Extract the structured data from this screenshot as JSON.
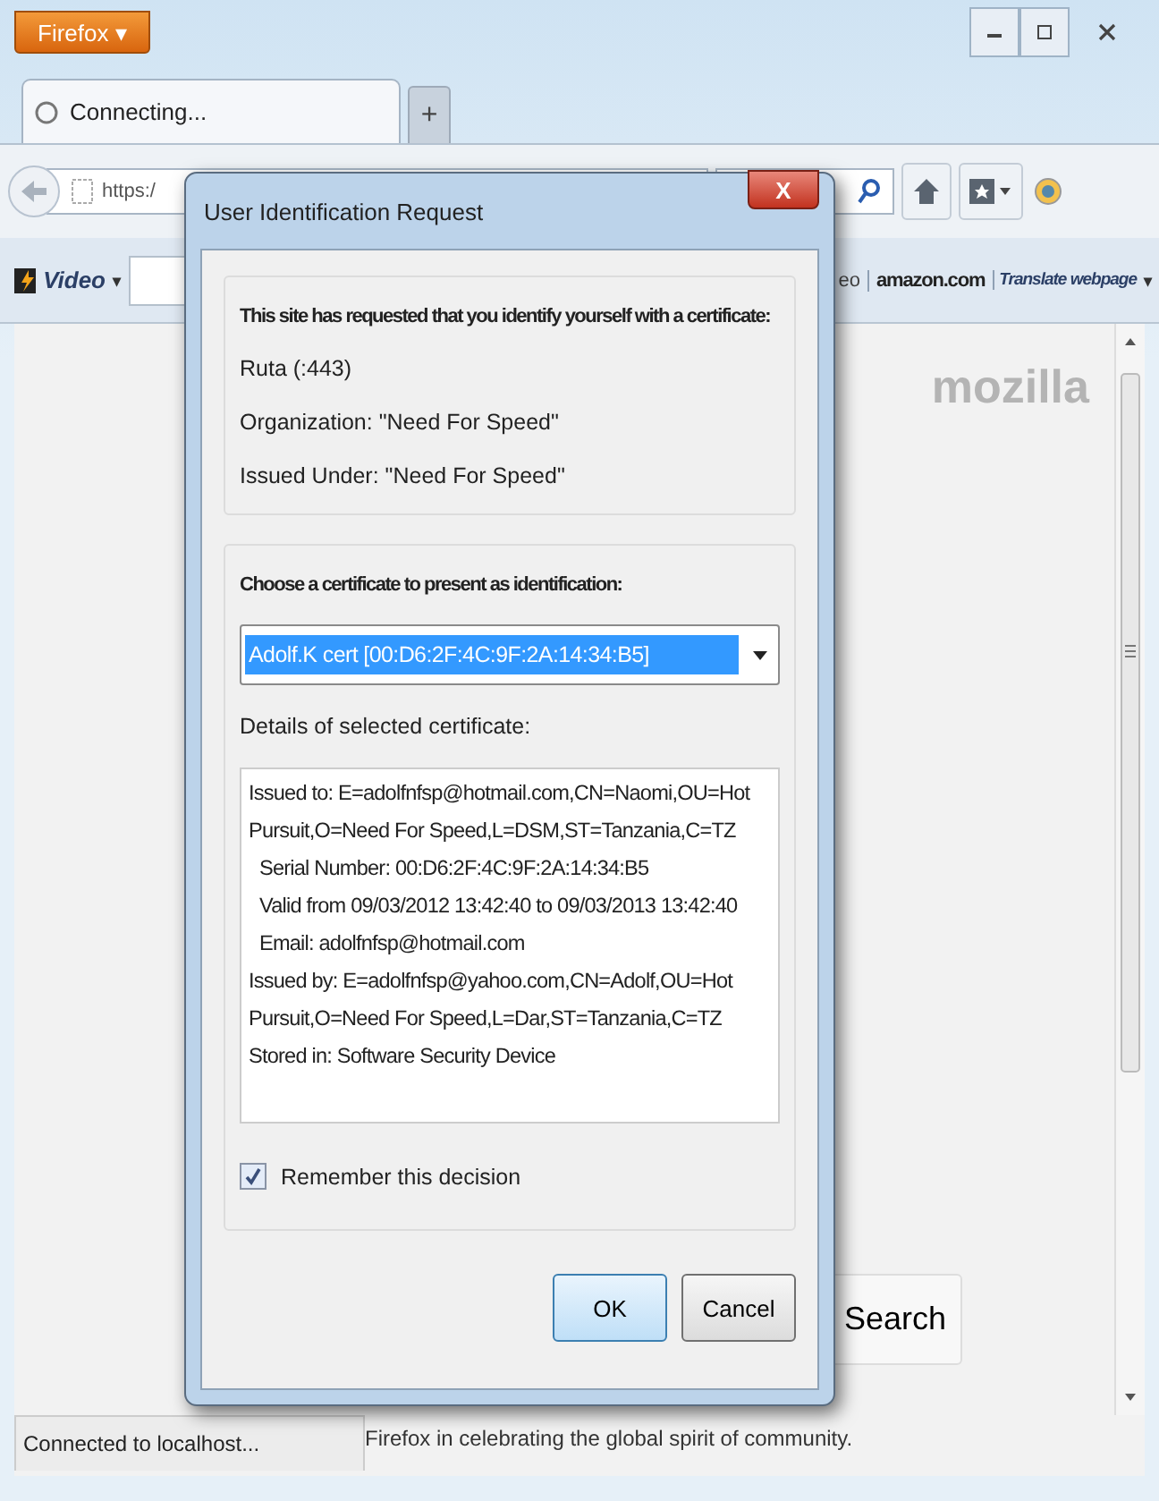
{
  "browser": {
    "menu_button": "Firefox ▾",
    "tabs": [
      {
        "label": "Connecting...",
        "selected": true
      }
    ],
    "new_tab": "+",
    "url": "https:/",
    "bookmarks": [
      {
        "kind": "menu",
        "label": "Video",
        "caret": "▾"
      },
      {
        "kind": "field"
      },
      {
        "kind": "text",
        "label": "eo"
      },
      {
        "kind": "logo",
        "label": "amazon.com"
      },
      {
        "kind": "menu",
        "label": "Translate webpage",
        "caret": "▾"
      }
    ],
    "page": {
      "logo": "mozilla",
      "search_button": "Search",
      "footer_text": "Firefox in celebrating the global spirit of community."
    },
    "status_bar": "Connected to localhost..."
  },
  "dialog": {
    "title": "User Identification Request",
    "close": "X",
    "request": {
      "heading": "This site has requested that you identify yourself with a certificate:",
      "lines": [
        "Ruta (:443)",
        "Organization: \"Need For Speed\"",
        "Issued Under: \"Need For Speed\""
      ]
    },
    "choose": {
      "heading": "Choose a certificate to present as identification:",
      "selected_certificate": "Adolf.K cert [00:D6:2F:4C:9F:2A:14:34:B5]",
      "details_label": "Details of selected certificate:",
      "details": [
        {
          "text": "Issued to: E=adolfnfsp@hotmail.com,CN=Naomi,OU=Hot",
          "indent": false
        },
        {
          "text": "Pursuit,O=Need For Speed,L=DSM,ST=Tanzania,C=TZ",
          "indent": false
        },
        {
          "text": "Serial Number: 00:D6:2F:4C:9F:2A:14:34:B5",
          "indent": true
        },
        {
          "text": "Valid from 09/03/2012 13:42:40 to 09/03/2013 13:42:40",
          "indent": true
        },
        {
          "text": "Email: adolfnfsp@hotmail.com",
          "indent": true
        },
        {
          "text": "Issued by: E=adolfnfsp@yahoo.com,CN=Adolf,OU=Hot",
          "indent": false
        },
        {
          "text": "Pursuit,O=Need For Speed,L=Dar,ST=Tanzania,C=TZ",
          "indent": false
        },
        {
          "text": "Stored in: Software Security Device",
          "indent": false
        }
      ],
      "remember": {
        "label": "Remember this decision",
        "checked": true
      }
    },
    "buttons": [
      {
        "label": "OK",
        "default": true
      },
      {
        "label": "Cancel",
        "default": false
      }
    ]
  }
}
